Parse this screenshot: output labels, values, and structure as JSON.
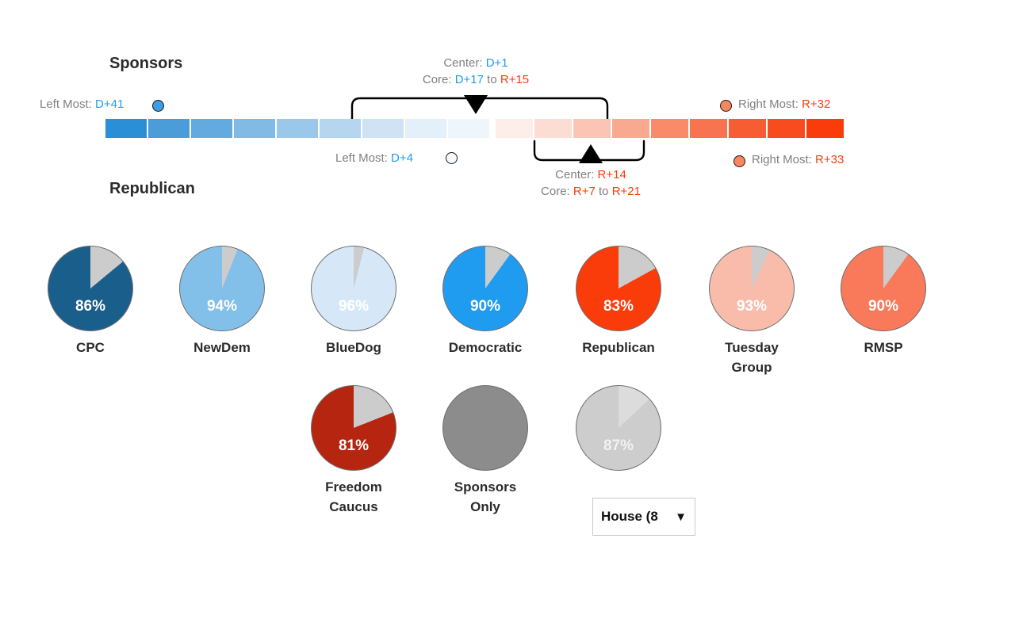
{
  "scale": {
    "sponsors": {
      "title": "Sponsors",
      "left_most_label": "Left Most:",
      "left_most_value": "D+41",
      "right_most_label": "Right Most:",
      "right_most_value": "R+32",
      "center_label": "Center:",
      "center_value": "D+1",
      "core_label": "Core:",
      "core_low": "D+17",
      "core_to": "to",
      "core_high": "R+15",
      "left_dot_color": "#3d9de0",
      "right_dot_color": "#f9865e"
    },
    "republican": {
      "title": "Republican",
      "left_most_label": "Left Most:",
      "left_most_value": "D+4",
      "right_most_label": "Right Most:",
      "right_most_value": "R+33",
      "center_label": "Center:",
      "center_value": "R+14",
      "core_label": "Core:",
      "core_low": "R+7",
      "core_to": "to",
      "core_high": "R+21",
      "left_dot_color": "#f4f9fd",
      "right_dot_color": "#f9865e"
    },
    "dem_segment_colors": [
      "#2b8fd8",
      "#4a9dd9",
      "#63abdf",
      "#81bae5",
      "#9ac8ea",
      "#b6d6f0",
      "#cfe3f5",
      "#e3eff9",
      "#eef6fc"
    ],
    "rep_segment_colors": [
      "#fdeeea",
      "#fbddd4",
      "#fbc4b4",
      "#f9a98f",
      "#f98b6b",
      "#f87350",
      "#f75c33",
      "#f84c1f",
      "#fa3c0a"
    ],
    "accent_dem": "#1f9cf0",
    "accent_rep": "#f93e0a"
  },
  "pies": {
    "row1": [
      {
        "label": "CPC",
        "pct": "86%",
        "value": 86,
        "color": "#1a5e8c"
      },
      {
        "label": "NewDem",
        "pct": "94%",
        "value": 94,
        "color": "#83c0e9"
      },
      {
        "label": "BlueDog",
        "pct": "96%",
        "value": 96,
        "color": "#d6e8f7"
      },
      {
        "label": "Democratic",
        "pct": "90%",
        "value": 90,
        "color": "#1f9cf0"
      },
      {
        "label": "Republican",
        "pct": "83%",
        "value": 83,
        "color": "#fa3c0a"
      },
      {
        "label": "Tuesday\nGroup",
        "pct": "93%",
        "value": 93,
        "color": "#f9bcaa"
      },
      {
        "label": "RMSP",
        "pct": "90%",
        "value": 90,
        "color": "#f87a5b"
      }
    ],
    "row2": [
      {
        "label": "Freedom\nCaucus",
        "pct": "81%",
        "value": 81,
        "color": "#b52510"
      },
      {
        "label": "Sponsors\nOnly",
        "pct": "",
        "value": 100,
        "color": "#8c8c8c"
      },
      {
        "label": "",
        "pct": "87%",
        "value": 87,
        "color": "#cdcdcd"
      }
    ],
    "remainder_color": "#cccccc",
    "remainder_color_light": "#dcdcdc"
  },
  "chamber_select": {
    "value": "House (8",
    "caret": "▼"
  }
}
